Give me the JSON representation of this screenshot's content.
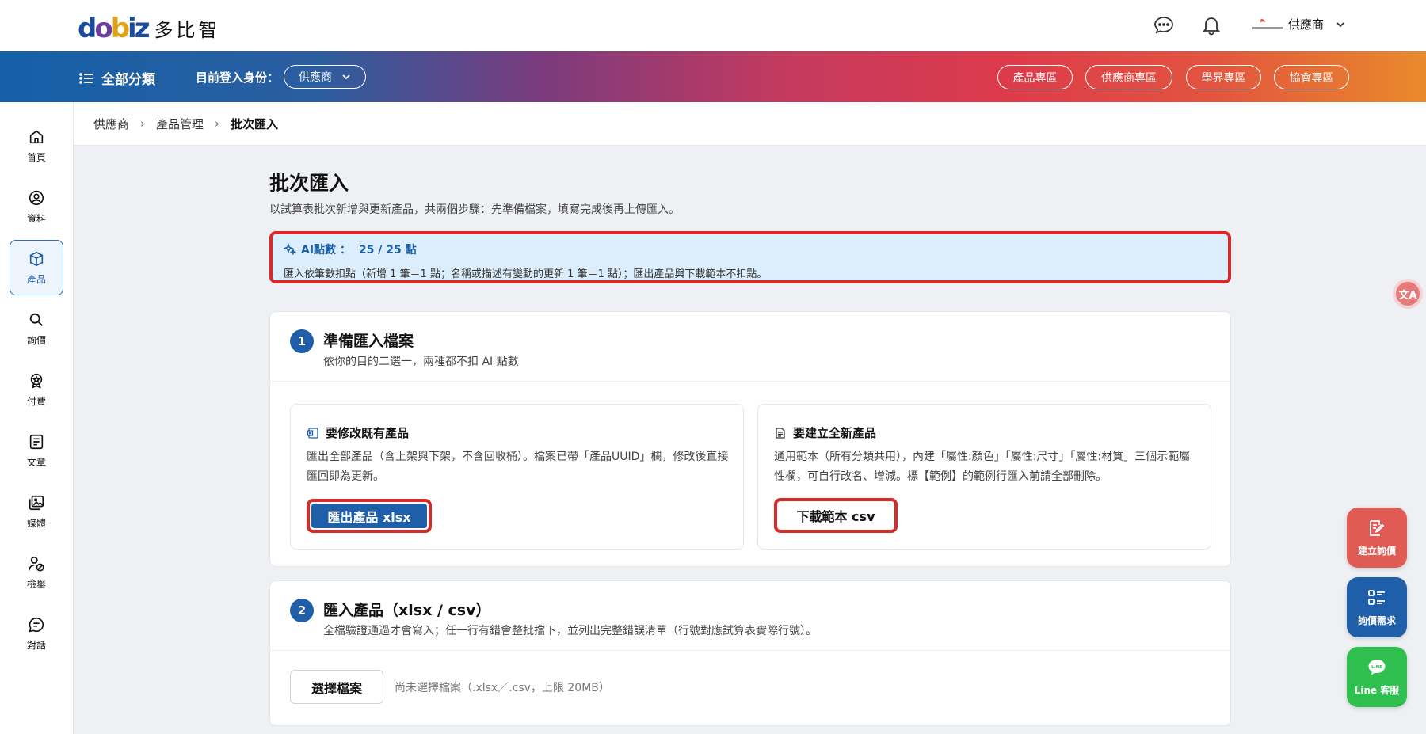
{
  "brand": {
    "logo_text": "多比智"
  },
  "header": {
    "user_name": "供應商"
  },
  "nav": {
    "all_categories": "全部分類",
    "login_as_label": "目前登入身份：",
    "role": "供應商",
    "zones": [
      "產品專區",
      "供應商專區",
      "學界專區",
      "協會專區"
    ]
  },
  "sidebar": {
    "items": [
      {
        "label": "首頁",
        "icon": "home-icon"
      },
      {
        "label": "資料",
        "icon": "user-circle-icon"
      },
      {
        "label": "產品",
        "icon": "box-icon",
        "active": true
      },
      {
        "label": "詢價",
        "icon": "search-icon"
      },
      {
        "label": "付費",
        "icon": "badge-icon"
      },
      {
        "label": "文章",
        "icon": "article-icon"
      },
      {
        "label": "媒體",
        "icon": "media-icon"
      },
      {
        "label": "檢舉",
        "icon": "report-icon"
      },
      {
        "label": "對話",
        "icon": "chat-icon"
      }
    ]
  },
  "breadcrumb": {
    "items": [
      "供應商",
      "產品管理",
      "批次匯入"
    ]
  },
  "page": {
    "title": "批次匯入",
    "description": "以試算表批次新增與更新產品，共兩個步驟：先準備檔案，填寫完成後再上傳匯入。"
  },
  "ai": {
    "label": "AI點數 ：",
    "value": "25 / 25 點",
    "note": "匯入依筆數扣點（新增 1 筆＝1 點；名稱或描述有變動的更新 1 筆＝1 點）；匯出產品與下載範本不扣點。"
  },
  "step1": {
    "num": "1",
    "title": "準備匯入檔案",
    "subtitle": "依你的目的二選一，兩種都不扣 AI 點數",
    "modify": {
      "title": "要修改既有產品",
      "desc": "匯出全部產品（含上架與下架，不含回收桶）。檔案已帶「產品UUID」欄，修改後直接匯回即為更新。",
      "button": "匯出產品 xlsx"
    },
    "create": {
      "title": "要建立全新產品",
      "desc": "通用範本（所有分類共用），內建「屬性:顏色」「屬性:尺寸」「屬性:材質」三個示範屬性欄，可自行改名、增減。標【範例】的範例行匯入前請全部刪除。",
      "button": "下載範本 csv"
    }
  },
  "step2": {
    "num": "2",
    "title": "匯入產品（xlsx / csv）",
    "subtitle": "全檔驗證通過才會寫入；任一行有錯會整批擋下，並列出完整錯誤清單（行號對應試算表實際行號）。",
    "choose_button": "選擇檔案",
    "no_file": "尚未選擇檔案（.xlsx／.csv，上限 20MB）"
  },
  "fabs": {
    "create_inquiry": "建立詢價",
    "inquiry_needs": "詢價需求",
    "line_service": "Line 客服",
    "line_logo": "LINE"
  },
  "translate": {
    "label": "文A"
  },
  "colors": {
    "primary": "#1f5ea8",
    "highlight_border": "#d92a2a",
    "ai_bg": "#dceefb",
    "fab_red": "#e15b55",
    "fab_blue": "#1f5ea8",
    "fab_green": "#2fbf4f"
  }
}
